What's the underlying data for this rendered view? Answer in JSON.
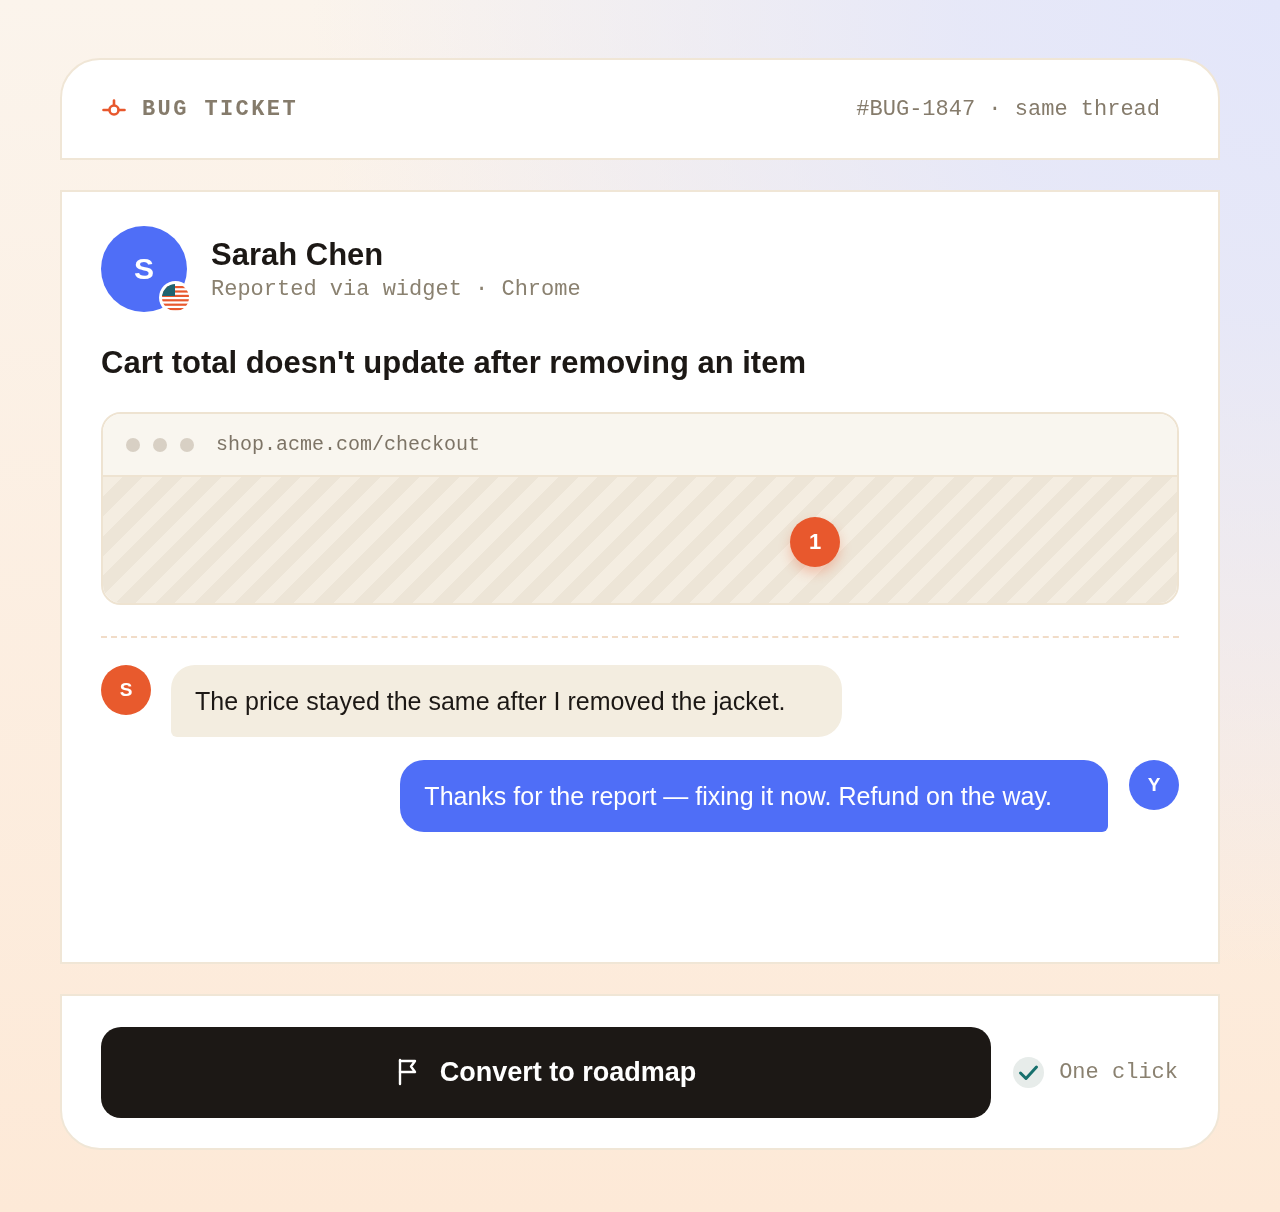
{
  "header": {
    "label": "BUG TICKET",
    "reference": "#BUG-1847 · same thread"
  },
  "reporter": {
    "initial": "S",
    "name": "Sarah Chen",
    "meta": "Reported via widget · Chrome"
  },
  "ticket": {
    "title": "Cart total doesn't update after removing an item"
  },
  "screenshot": {
    "url": "shop.acme.com/checkout",
    "pins": [
      {
        "label": "1"
      }
    ]
  },
  "messages": [
    {
      "kind": "incoming",
      "initial": "S",
      "text": "The price stayed the same after I removed the jacket."
    },
    {
      "kind": "outgoing",
      "initial": "Y",
      "text": "Thanks for the report — fixing it now. Refund on the way."
    }
  ],
  "footer": {
    "button": "Convert to roadmap",
    "note": "One click"
  }
}
